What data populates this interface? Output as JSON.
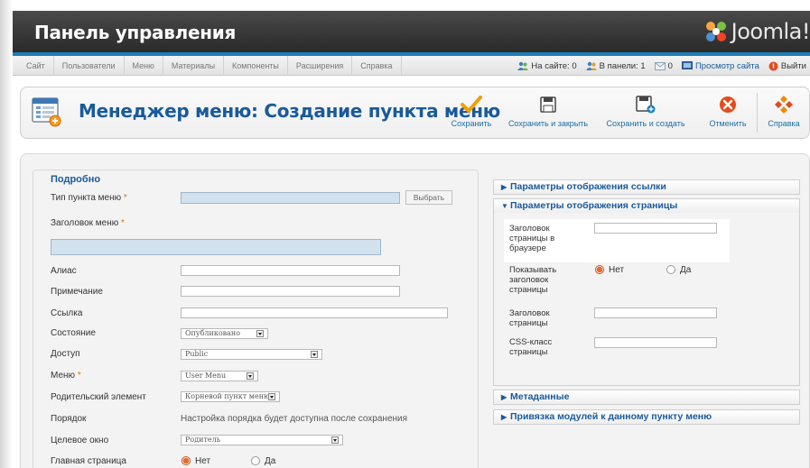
{
  "header": {
    "title": "Панель управления",
    "logo_text": "Joomla!"
  },
  "menubar": {
    "items": [
      "Сайт",
      "Пользователи",
      "Меню",
      "Материалы",
      "Компоненты",
      "Расширения",
      "Справка"
    ],
    "status": {
      "online": "На сайте: 0",
      "admin": "В панели: 1",
      "messages": "0",
      "view_site": "Просмотр сайта",
      "logout": "Выйти"
    }
  },
  "toolbar": {
    "title": "Менеджер меню: Создание пункта меню",
    "buttons": {
      "save": "Сохранить",
      "save_close": "Сохранить и закрыть",
      "save_new": "Сохранить и создать",
      "cancel": "Отменить",
      "help": "Справка"
    }
  },
  "details": {
    "legend": "Подробно",
    "type_label": "Тип пункта меню",
    "type_button": "Выбрать",
    "title_label": "Заголовок меню",
    "alias_label": "Алиас",
    "note_label": "Примечание",
    "link_label": "Ссылка",
    "state_label": "Состояние",
    "state_value": "Опубликовано",
    "access_label": "Доступ",
    "access_value": "Public",
    "menu_label": "Меню",
    "menu_value": "User Menu",
    "parent_label": "Родительский элемент",
    "parent_value": "Корневой пункт меню",
    "order_label": "Порядок",
    "order_note": "Настройка порядка будет доступна после сохранения",
    "target_label": "Целевое окно",
    "target_value": "Родитель",
    "home_label": "Главная страница",
    "home_no": "Нет",
    "home_yes": "Да",
    "required_mark": "*"
  },
  "params": {
    "link_display": "Параметры отображения ссылки",
    "page_display": "Параметры отображения страницы",
    "browser_title_label": "Заголовок страницы в браузере",
    "show_title_label": "Показывать заголовок страницы",
    "show_title_no": "Нет",
    "show_title_yes": "Да",
    "page_heading_label": "Заголовок страницы",
    "css_class_label": "CSS-класс страницы",
    "metadata": "Метаданные",
    "modules": "Привязка модулей к данному пункту меню"
  }
}
